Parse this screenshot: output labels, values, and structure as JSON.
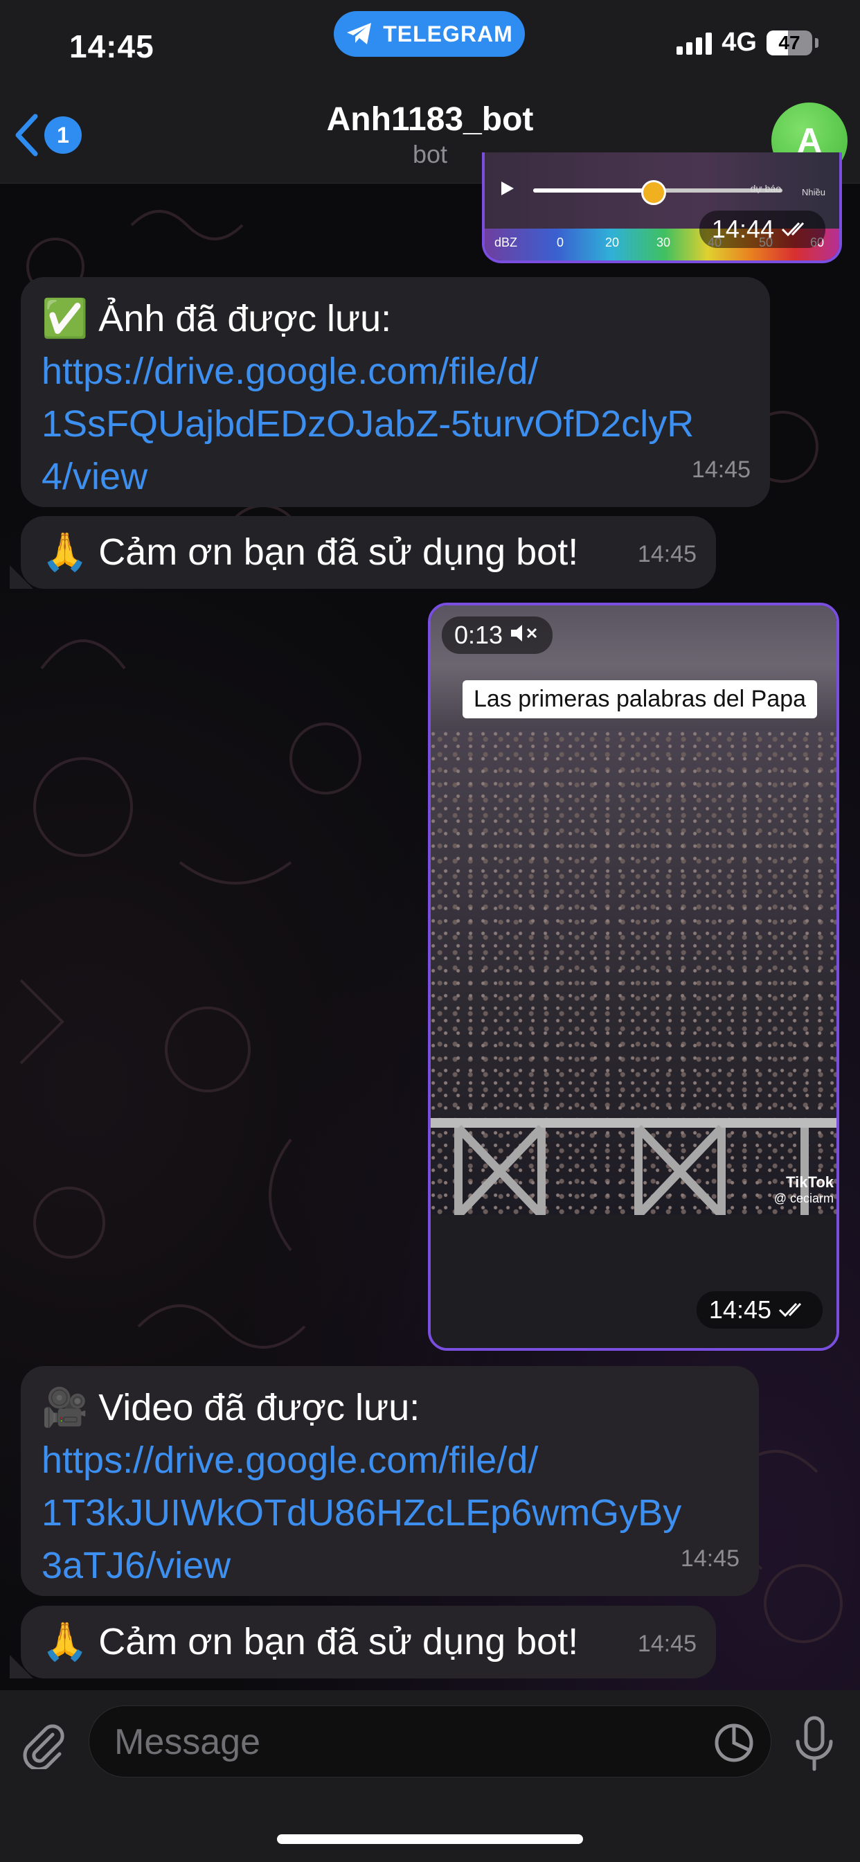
{
  "status_bar": {
    "time": "14:45",
    "app_pill": "TELEGRAM",
    "network": "4G",
    "battery": "47",
    "battery_level": 0.47
  },
  "header": {
    "back_badge": "1",
    "title": "Anh1183_bot",
    "subtitle": "bot",
    "avatar_letter": "A"
  },
  "top_media": {
    "time": "14:44",
    "scale_label": "dBZ",
    "scale_ticks": [
      "0",
      "20",
      "30",
      "40",
      "50",
      "60"
    ],
    "corner_text": "Nhiều",
    "top_text": "dự báo"
  },
  "messages": [
    {
      "title": "✅ Ảnh đã được lưu:",
      "link": "https://drive.google.com/file/d/1SsFQUajbdEDzOJabZ-5turvOfD2clyR4/view",
      "link_lines": [
        "https://drive.google.com/file/d/",
        "1SsFQUajbdEDzOJabZ-5turvOfD2clyR",
        "4/view"
      ],
      "time": "14:45"
    },
    {
      "text": "🙏 Cảm ơn bạn đã sử dụng bot!",
      "time": "14:45"
    },
    {
      "video": true,
      "duration": "0:13",
      "caption": "Las primeras palabras del Papa",
      "watermark_brand": "TikTok",
      "watermark_user": "@ ceciarm",
      "time": "14:45"
    },
    {
      "title": "🎥 Video đã được lưu:",
      "link": "https://drive.google.com/file/d/1T3kJUIWkOTdU86HZcLEp6wmGyBy3aTJ6/view",
      "link_lines": [
        "https://drive.google.com/file/d/",
        "1T3kJUIWkOTdU86HZcLEp6wmGyBy",
        "3aTJ6/view"
      ],
      "time": "14:45"
    },
    {
      "text": "🙏 Cảm ơn bạn đã sử dụng bot!",
      "time": "14:45"
    }
  ],
  "composer": {
    "placeholder": "Message"
  },
  "colors": {
    "accent": "#2f8cf0",
    "link": "#3d8ff0",
    "bubble_in": "#232227",
    "bubble_out_border": "#7a4fe0"
  }
}
